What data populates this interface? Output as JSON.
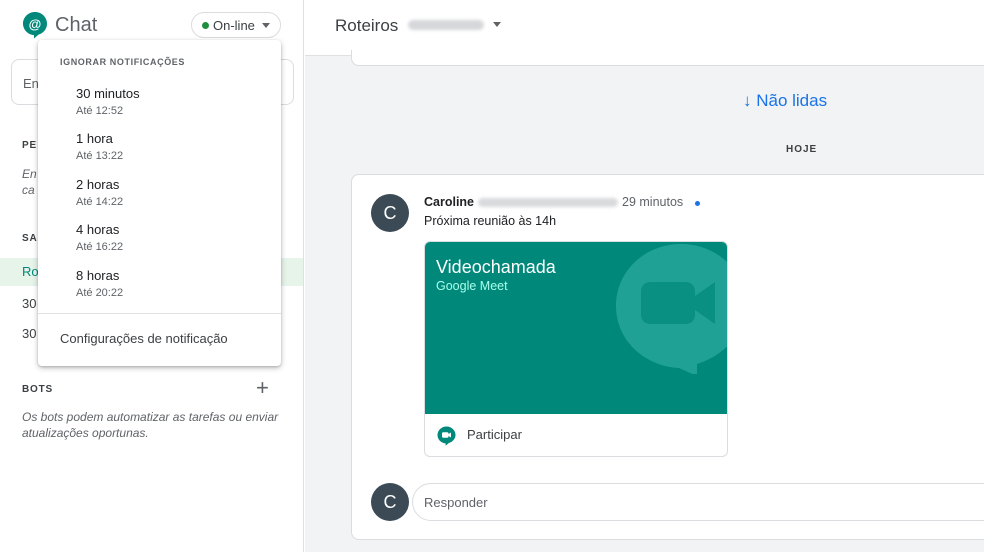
{
  "sidebar": {
    "app_title": "Chat",
    "status_label": "On-line",
    "search_text": "En",
    "section_people": "PE",
    "people_text_line1": "En",
    "people_text_line2": "ca",
    "section_rooms": "SA",
    "room_items": [
      "Ro",
      "30",
      "30"
    ],
    "bots_label": "BOTS",
    "bots_add": "+",
    "bots_text": "Os bots podem automatizar as tarefas ou enviar atualizações oportunas."
  },
  "menu": {
    "header": "IGNORAR NOTIFICAÇÕES",
    "items": [
      {
        "title": "30 minutos",
        "sub": "Até 12:52"
      },
      {
        "title": "1 hora",
        "sub": "Até 13:22"
      },
      {
        "title": "2 horas",
        "sub": "Até 14:22"
      },
      {
        "title": "4 horas",
        "sub": "Até 16:22"
      },
      {
        "title": "8 horas",
        "sub": "Até 20:22"
      }
    ],
    "settings": "Configurações de notificação"
  },
  "main": {
    "room_title": "Roteiros",
    "unread_label": "↓ Não lidas",
    "today_label": "HOJE",
    "message": {
      "avatar_letter": "C",
      "sender_first": "Caroline",
      "time": "29 minutos",
      "text": "Próxima reunião às 14h",
      "meet_title": "Videochamada",
      "meet_subtitle": "Google Meet",
      "join_label": "Participar"
    },
    "reply_avatar_letter": "C",
    "reply_placeholder": "Responder"
  },
  "colors": {
    "accent_green": "#00897b",
    "link_blue": "#1a73e8",
    "online_green": "#1e8e3e"
  }
}
